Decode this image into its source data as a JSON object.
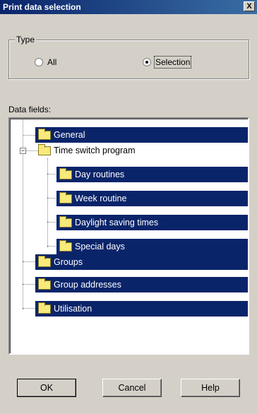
{
  "window": {
    "title": "Print data selection",
    "close_glyph": "X"
  },
  "type_group": {
    "legend": "Type",
    "options": [
      {
        "label": "All",
        "selected": false
      },
      {
        "label": "Selection",
        "selected": true
      }
    ]
  },
  "fields": {
    "label": "Data fields:",
    "items": [
      {
        "label": "General",
        "selected": true
      },
      {
        "label": "Time switch program",
        "selected": false,
        "expander": "−"
      },
      {
        "label": "Day routines",
        "selected": true
      },
      {
        "label": "Week routine",
        "selected": true
      },
      {
        "label": "Daylight saving times",
        "selected": true
      },
      {
        "label": "Special days",
        "selected": true
      },
      {
        "label": "Groups",
        "selected": true
      },
      {
        "label": "Group addresses",
        "selected": true
      },
      {
        "label": "Utilisation",
        "selected": true
      }
    ]
  },
  "buttons": {
    "ok": "OK",
    "cancel": "Cancel",
    "help": "Help"
  },
  "colors": {
    "selection": "#0a246a",
    "face": "#d4d0c8"
  }
}
